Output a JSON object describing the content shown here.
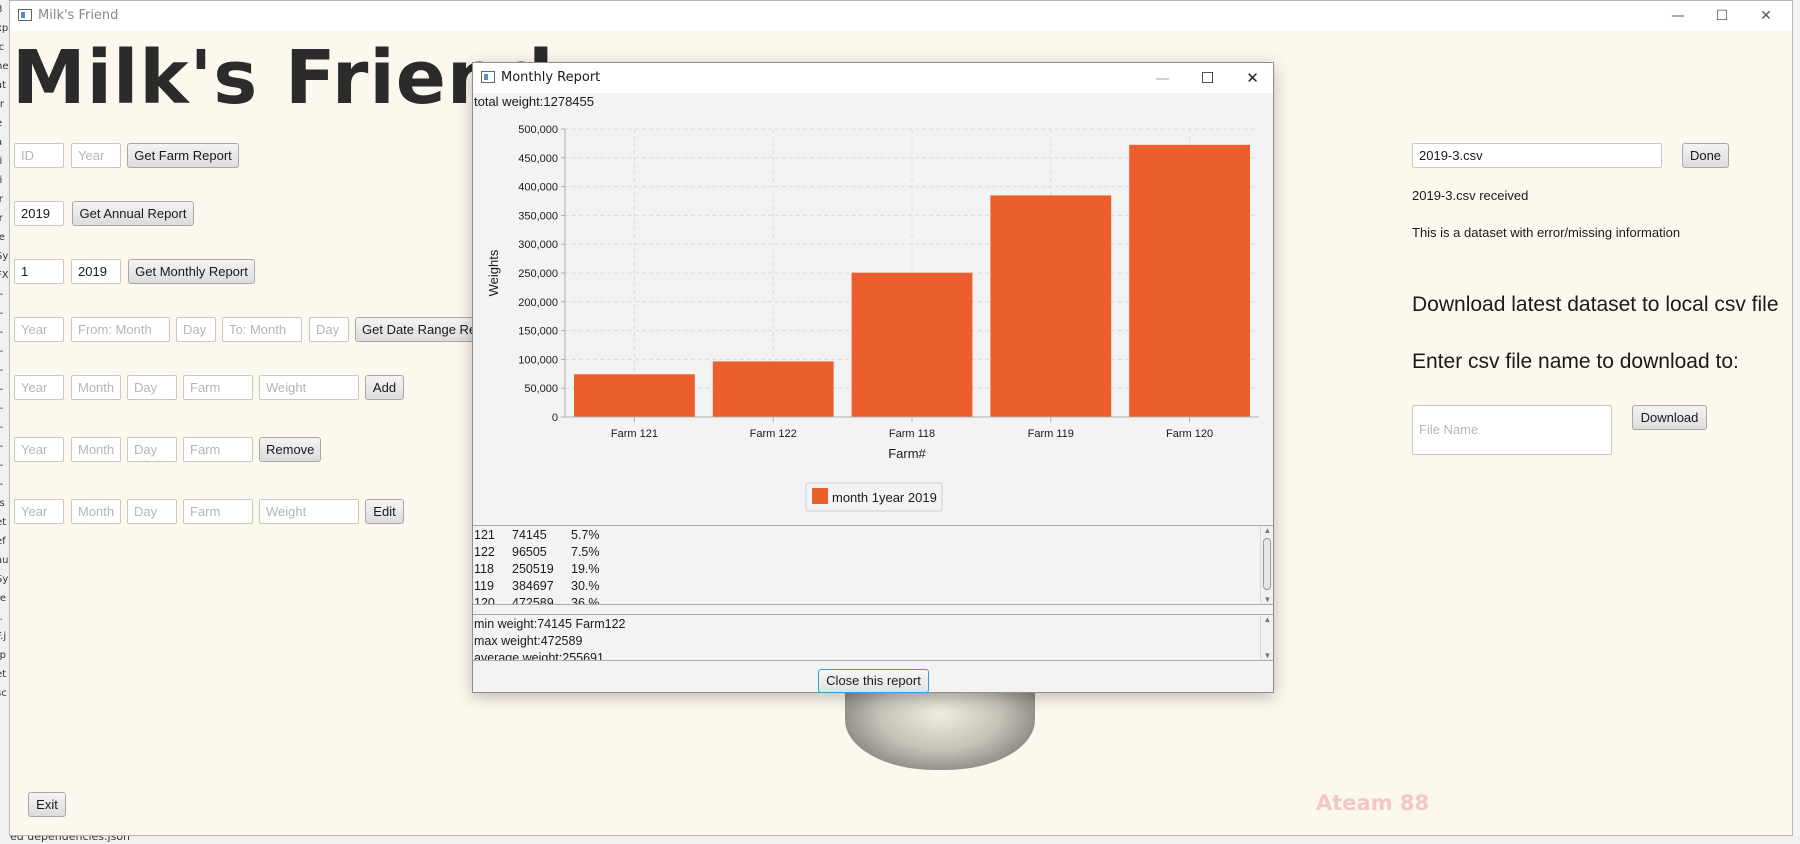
{
  "background": {
    "left_fragments": [
      "8",
      "xp",
      "ic",
      "he",
      "at",
      "rr",
      "e",
      "a",
      "fi",
      "fi",
      "ir",
      "ir",
      "je",
      "Sy",
      "FX",
      "--",
      "--",
      "--",
      "--",
      "--",
      "--",
      "--",
      "--",
      "--",
      "--",
      "--",
      "fs",
      "et",
      "ef",
      "au",
      "Sy",
      "re",
      "-.",
      "F.j",
      "-p",
      "et",
      "sc"
    ],
    "bottom_text": "ed dependencies.json"
  },
  "main_window": {
    "title": "Milk's Friend",
    "heading": "Milk's Friend",
    "farm_report": {
      "id_placeholder": "ID",
      "year_placeholder": "Year",
      "button": "Get Farm Report"
    },
    "annual_report": {
      "year_value": "2019",
      "button": "Get Annual Report"
    },
    "monthly_report": {
      "month_value": "1",
      "year_value": "2019",
      "button": "Get Monthly Report"
    },
    "date_range": {
      "year_placeholder": "Year",
      "from_month_placeholder": "From: Month",
      "from_day_placeholder": "Day",
      "to_month_placeholder": "To: Month",
      "to_day_placeholder": "Day",
      "button": "Get Date Range Re"
    },
    "add_row": {
      "year": "Year",
      "month": "Month",
      "day": "Day",
      "farm": "Farm",
      "weight": "Weight",
      "button": "Add"
    },
    "remove_row": {
      "year": "Year",
      "month": "Month",
      "day": "Day",
      "farm": "Farm",
      "button": "Remove"
    },
    "edit_row": {
      "year": "Year",
      "month": "Month",
      "day": "Day",
      "farm": "Farm",
      "weight": "Weight",
      "button": "Edit"
    },
    "exit_button": "Exit",
    "right_panel": {
      "file_value": "2019-3.csv",
      "done_button": "Done",
      "received_text": "2019-3.csv received",
      "dataset_note": "This is a dataset with error/missing information",
      "download_heading": "Download latest dataset to local csv file",
      "enter_name_heading": "Enter csv file name to download to:",
      "file_name_placeholder": "File Name",
      "download_button": "Download"
    },
    "footer": "Ateam 88"
  },
  "dialog": {
    "title": "Monthly Report",
    "total_weight": "total weight:1278455",
    "list_rows": [
      [
        "121",
        "74145",
        "5.7%"
      ],
      [
        "122",
        "96505",
        "7.5%"
      ],
      [
        "118",
        "250519",
        "19.%"
      ],
      [
        "119",
        "384697",
        "30.%"
      ],
      [
        "120",
        "472589",
        "36.%"
      ]
    ],
    "stats": [
      "min weight:74145    Farm122",
      "max weight:472589",
      "average weight:255691"
    ],
    "close_button": "Close this report"
  },
  "chart_data": {
    "type": "bar",
    "categories": [
      "Farm 121",
      "Farm 122",
      "Farm 118",
      "Farm 119",
      "Farm 120"
    ],
    "series": [
      {
        "name": "month 1year 2019",
        "values": [
          74145,
          96505,
          250519,
          384697,
          472589
        ]
      }
    ],
    "xlabel": "Farm#",
    "ylabel": "Weights",
    "ylim": [
      0,
      500000
    ],
    "yticks": [
      "0",
      "50,000",
      "100,000",
      "150,000",
      "200,000",
      "250,000",
      "300,000",
      "350,000",
      "400,000",
      "450,000",
      "500,000"
    ],
    "bar_color": "#ec5e2c",
    "grid": true,
    "legend_position": "bottom"
  }
}
